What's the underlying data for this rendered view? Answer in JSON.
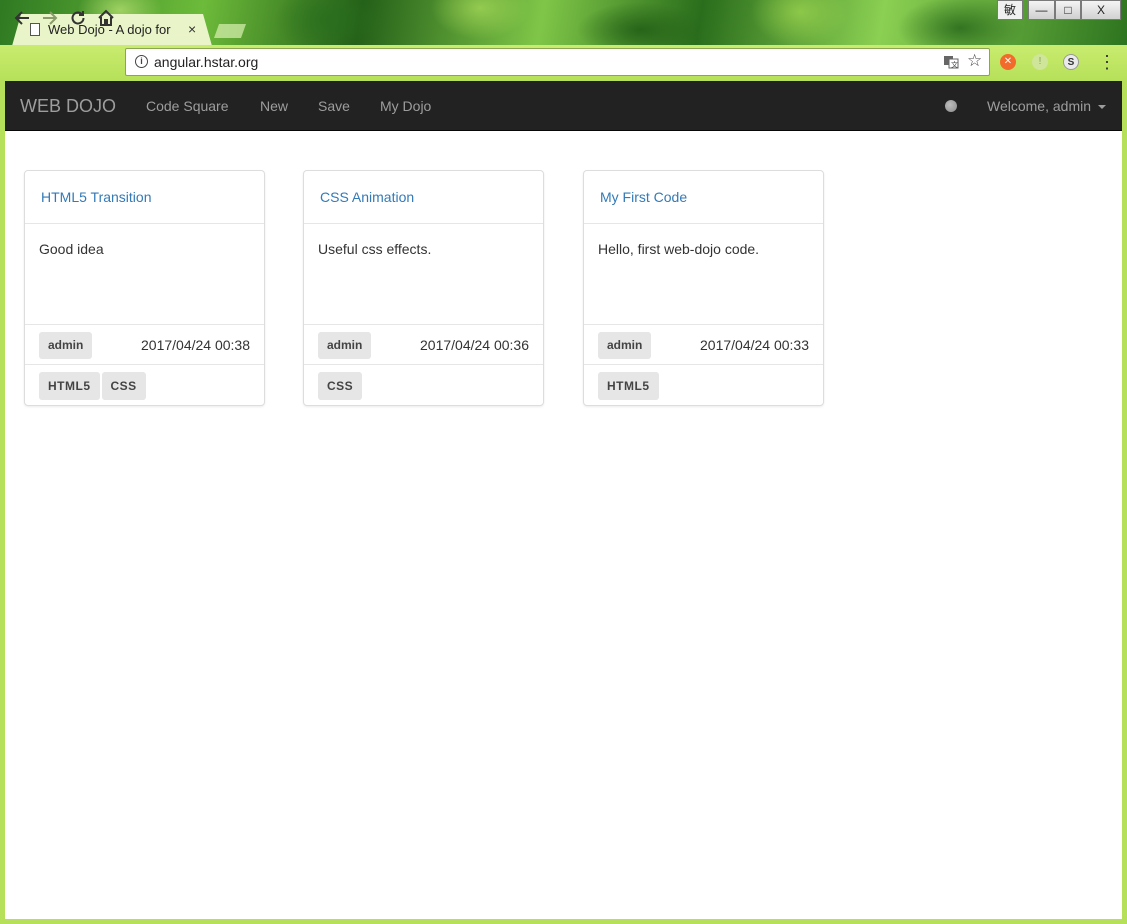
{
  "browser": {
    "tab_title": "Web Dojo - A dojo for",
    "tab_close": "×",
    "url": "angular.hstar.org",
    "ime_label": "敏",
    "window_controls": {
      "minimize": "—",
      "maximize": "□",
      "close": "X"
    },
    "ext_third_label": "S",
    "icons": [
      "back-icon",
      "forward-icon",
      "reload-icon",
      "home-icon",
      "info-icon",
      "translate-icon",
      "star-icon",
      "menu-dots-icon"
    ]
  },
  "navbar": {
    "brand": "WEB DOJO",
    "links": [
      "Code Square",
      "New",
      "Save",
      "My Dojo"
    ],
    "user": "Welcome, admin"
  },
  "cards": [
    {
      "title": "HTML5 Transition",
      "description": "Good idea",
      "author": "admin",
      "date": "2017/04/24 00:38",
      "tags": [
        "HTML5",
        "CSS"
      ]
    },
    {
      "title": "CSS Animation",
      "description": "Useful css effects.",
      "author": "admin",
      "date": "2017/04/24 00:36",
      "tags": [
        "CSS"
      ]
    },
    {
      "title": "My First Code",
      "description": "Hello, first web-dojo code.",
      "author": "admin",
      "date": "2017/04/24 00:33",
      "tags": [
        "HTML5"
      ]
    }
  ],
  "colors": {
    "navbar_bg": "#222222",
    "link": "#337ab7",
    "label_bg": "#e6e6e6",
    "chrome_green": "#b6e05a"
  }
}
